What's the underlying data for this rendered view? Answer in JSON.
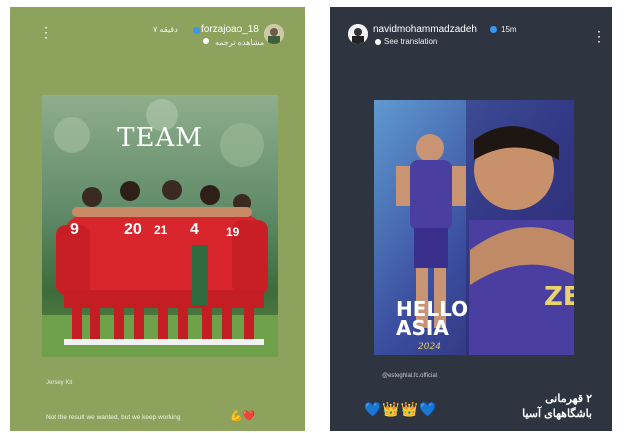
{
  "story_left": {
    "username": "forzajoao_18",
    "time": "۷ دقیقه",
    "subline": "مشاهده ترجمه",
    "image_title": "TEAM",
    "photo_credit": "Jersey Kit",
    "caption": "Not the result we wanted, but we keep working",
    "caption_emoji": "💪❤️",
    "jersey_numbers": [
      "9",
      "20",
      "21",
      "4",
      "19"
    ]
  },
  "story_right": {
    "username": "navidmohammadzadeh",
    "time": "15m",
    "subline": "See translation",
    "banner_line1": "HELLO",
    "banner_line2": "ASIA",
    "banner_script": "2024",
    "mention": "@esteghlal.fc.official",
    "jersey_letters": "ZE",
    "arabic_line1": "۲ قهرمانی",
    "arabic_line2": "باشگاههای آسیا",
    "emoji_row": "💙👑👑💙"
  },
  "colors": {
    "story_left_bg": "#8da25d",
    "story_right_bg": "#2e3540",
    "team_red": "#d8262c",
    "esteghlal_purple": "#4a3fa0"
  }
}
